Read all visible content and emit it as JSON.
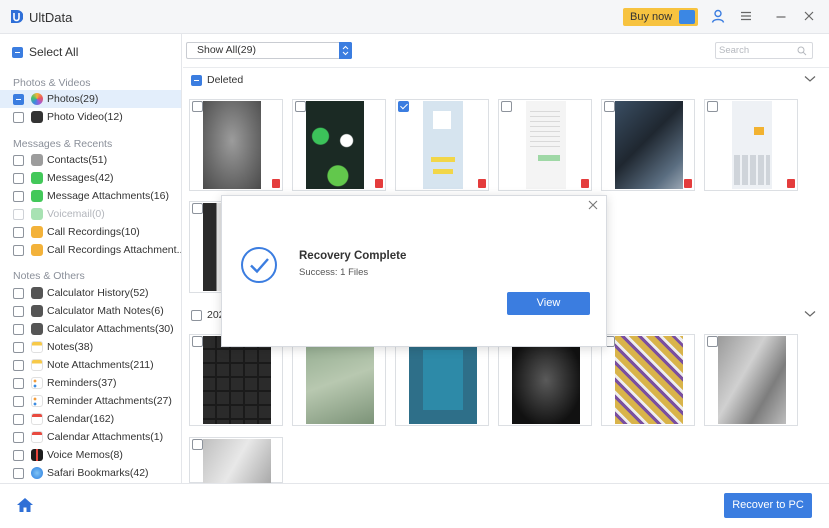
{
  "app": {
    "title": "UltData",
    "buy_label": "Buy now"
  },
  "sidebar": {
    "select_all": "Select All",
    "groups": [
      {
        "label": "Photos & Videos"
      },
      {
        "label": "Messages & Recents"
      },
      {
        "label": "Notes & Others"
      }
    ],
    "items": [
      {
        "label": "Photos(29)",
        "icon": "photos-icon"
      },
      {
        "label": "Photo Video(12)",
        "icon": "video-icon"
      },
      {
        "label": "Contacts(51)",
        "icon": "contacts-icon"
      },
      {
        "label": "Messages(42)",
        "icon": "messages-icon"
      },
      {
        "label": "Message Attachments(16)",
        "icon": "message-attachment-icon"
      },
      {
        "label": "Voicemail(0)",
        "icon": "voicemail-icon"
      },
      {
        "label": "Call Recordings(10)",
        "icon": "call-recording-icon"
      },
      {
        "label": "Call Recordings Attachment...",
        "icon": "call-recording-attachment-icon"
      },
      {
        "label": "Calculator History(52)",
        "icon": "calculator-icon"
      },
      {
        "label": "Calculator Math Notes(6)",
        "icon": "calculator-icon"
      },
      {
        "label": "Calculator Attachments(30)",
        "icon": "calculator-icon"
      },
      {
        "label": "Notes(38)",
        "icon": "notes-icon"
      },
      {
        "label": "Note Attachments(211)",
        "icon": "notes-icon"
      },
      {
        "label": "Reminders(37)",
        "icon": "reminders-icon"
      },
      {
        "label": "Reminder Attachments(27)",
        "icon": "reminders-icon"
      },
      {
        "label": "Calendar(162)",
        "icon": "calendar-icon"
      },
      {
        "label": "Calendar Attachments(1)",
        "icon": "calendar-icon"
      },
      {
        "label": "Voice Memos(8)",
        "icon": "voice-memo-icon"
      },
      {
        "label": "Safari Bookmarks(42)",
        "icon": "safari-icon"
      }
    ]
  },
  "toolbar": {
    "filter_value": "Show All(29)",
    "search_placeholder": "Search"
  },
  "sections": [
    {
      "label": "Deleted"
    },
    {
      "label": "202"
    }
  ],
  "dialog": {
    "title": "Recovery Complete",
    "subtitle": "Success: 1 Files",
    "view_label": "View"
  },
  "footer": {
    "recover_label": "Recover to PC"
  },
  "colors": {
    "accent": "#3b7de0",
    "buy": "#f7c340",
    "active_row": "#e3eefb"
  }
}
